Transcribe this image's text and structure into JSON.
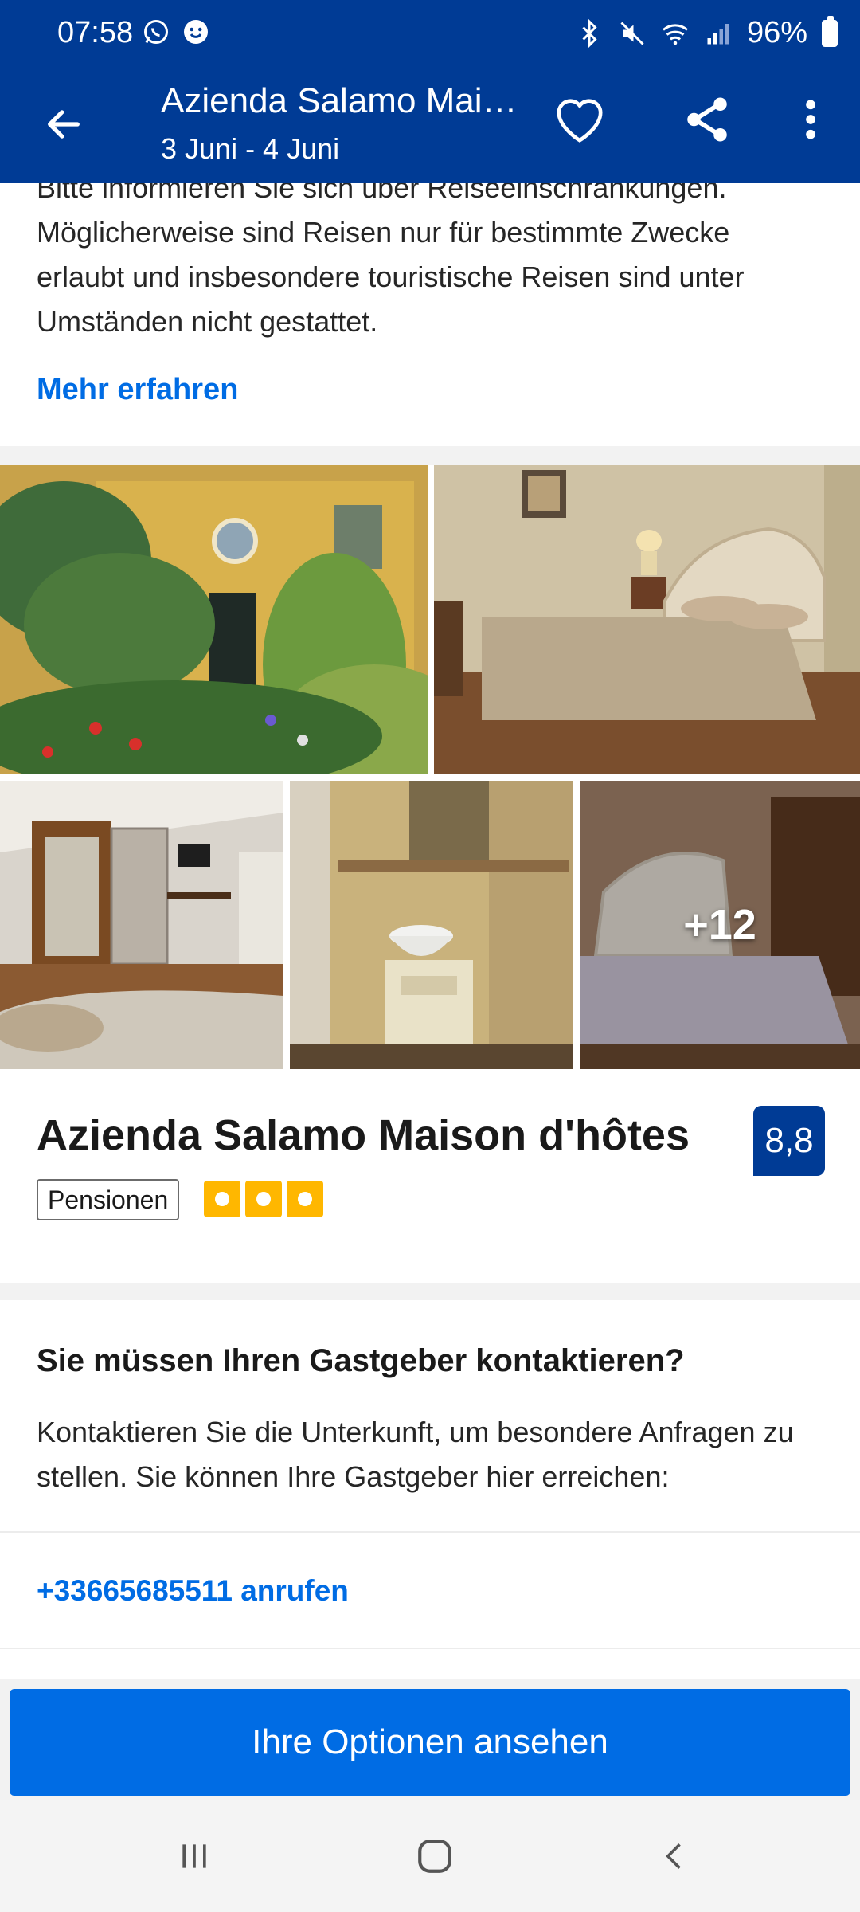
{
  "status_bar": {
    "time": "07:58",
    "battery": "96%",
    "left_icons": [
      "whatsapp-icon",
      "chat-bubble-icon"
    ],
    "right_icons": [
      "bluetooth-icon",
      "mute-icon",
      "wifi-icon",
      "signal-icon",
      "battery-icon"
    ]
  },
  "header": {
    "title": "Azienda Salamo Mai…",
    "dates": "3 Juni - 4 Juni",
    "background": "#003b95"
  },
  "notice": {
    "text": "Bitte informieren Sie sich über Reiseeinschränkungen. Möglicherweise sind Reisen nur für bestimmte Zwecke erlaubt und insbesondere touristische Reisen sind unter Umständen nicht gestattet.",
    "link": "Mehr erfahren"
  },
  "gallery": {
    "more_count": "+12"
  },
  "hotel": {
    "name": "Azienda Salamo Maison d'hôtes",
    "score": "8,8",
    "type": "Pensionen",
    "stars": 3
  },
  "contact": {
    "title": "Sie müssen Ihren Gastgeber kontaktieren?",
    "text": "Kontaktieren Sie die Unterkunft, um besondere Anfragen zu stellen. Sie können Ihre Gastgeber hier erreichen:",
    "phone_link": "+33665685511 anrufen"
  },
  "cta": {
    "label": "Ihre Optionen ansehen",
    "color": "#006ce4"
  },
  "nav": [
    "recent-apps-icon",
    "home-icon",
    "back-icon"
  ]
}
